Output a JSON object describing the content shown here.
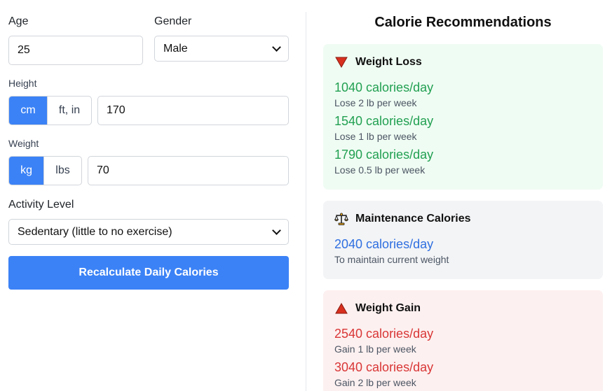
{
  "form": {
    "age_label": "Age",
    "age_value": "25",
    "gender_label": "Gender",
    "gender_value": "Male",
    "height_label": "Height",
    "height_units": [
      "cm",
      "ft, in"
    ],
    "height_active_unit": "cm",
    "height_value": "170",
    "weight_label": "Weight",
    "weight_units": [
      "kg",
      "lbs"
    ],
    "weight_active_unit": "kg",
    "weight_value": "70",
    "activity_label": "Activity Level",
    "activity_value": "Sedentary (little to no exercise)",
    "submit_label": "Recalculate Daily Calories"
  },
  "results": {
    "title": "Calorie Recommendations",
    "loss": {
      "heading": "Weight Loss",
      "icon": "red-triangle-down-icon",
      "items": [
        {
          "calories": "1040 calories/day",
          "note": "Lose 2 lb per week"
        },
        {
          "calories": "1540 calories/day",
          "note": "Lose 1 lb per week"
        },
        {
          "calories": "1790 calories/day",
          "note": "Lose 0.5 lb per week"
        }
      ]
    },
    "maintenance": {
      "heading": "Maintenance Calories",
      "icon": "balance-scale-icon",
      "items": [
        {
          "calories": "2040 calories/day",
          "note": "To maintain current weight"
        }
      ]
    },
    "gain": {
      "heading": "Weight Gain",
      "icon": "red-triangle-up-icon",
      "items": [
        {
          "calories": "2540 calories/day",
          "note": "Gain 1 lb per week"
        },
        {
          "calories": "3040 calories/day",
          "note": "Gain 2 lb per week"
        }
      ]
    }
  },
  "colors": {
    "accent": "#3b82f6",
    "loss_text": "#22a052",
    "maintenance_text": "#2f6fe0",
    "gain_text": "#d93636",
    "loss_bg": "#effcf3",
    "maintenance_bg": "#f3f4f6",
    "gain_bg": "#fdf0f0"
  }
}
